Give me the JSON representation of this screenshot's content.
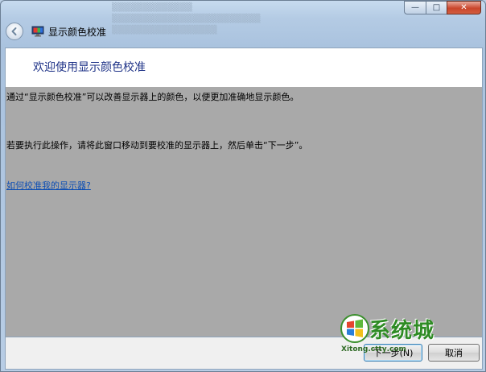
{
  "window": {
    "title": "显示颜色校准",
    "caption": {
      "minimize": "—",
      "maximize": "□",
      "close": "✕"
    }
  },
  "header": {
    "title": "欢迎使用显示颜色校准"
  },
  "body": {
    "paragraph1": "通过“显示颜色校准”可以改善显示器上的颜色，以便更加准确地显示颜色。",
    "paragraph2": "若要执行此操作，请将此窗口移动到要校准的显示器上，然后单击“下一步”。",
    "help_link": "如何校准我的显示器?"
  },
  "buttons": {
    "next": "下一步(N)",
    "cancel": "取消"
  },
  "watermark": {
    "title": "系统城",
    "url": "Xitong.cttу.com"
  },
  "colors": {
    "header_title": "#1e3287",
    "link": "#0e4fb4",
    "content_bg": "#a9a9a9"
  }
}
